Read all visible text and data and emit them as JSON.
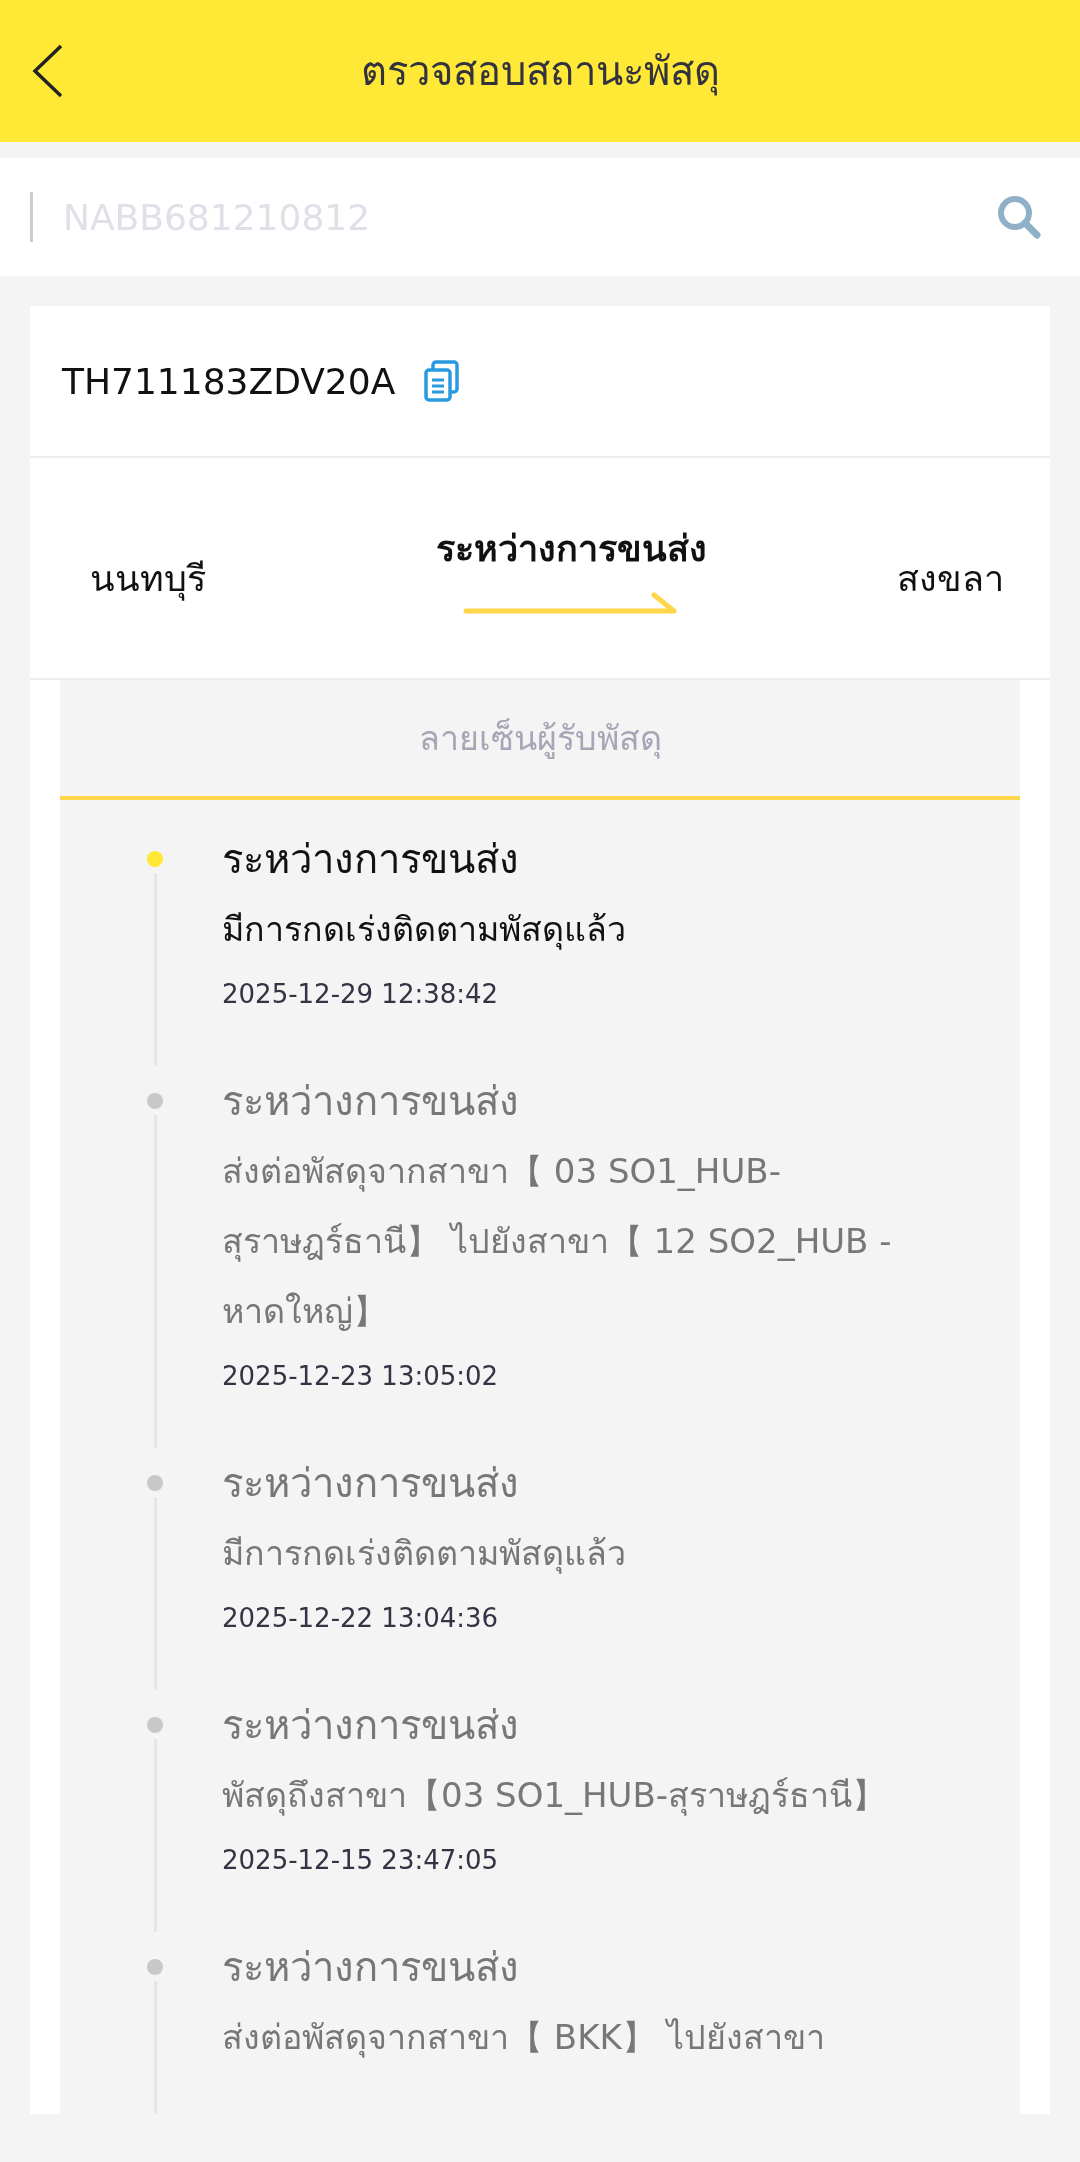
{
  "header": {
    "title": "ตรวจสอบสถานะพัสดุ"
  },
  "search": {
    "placeholder": "NABB681210812"
  },
  "parcel": {
    "tracking_number": "TH711183ZDV20A",
    "route": {
      "origin": "นนทบุรี",
      "status": "ระหว่างการขนส่ง",
      "destination": "สงขลา"
    },
    "signature_label": "ลายเซ็นผู้รับพัสดุ",
    "events": [
      {
        "status": "ระหว่างการขนส่ง",
        "detail": "มีการกดเร่งติดตามพัสดุแล้ว",
        "time": "2025-12-29 12:38:42",
        "current": true
      },
      {
        "status": "ระหว่างการขนส่ง",
        "detail": "ส่งต่อพัสดุจากสาขา【 03 SO1_HUB-สุราษฎร์ธานี】 ไปยังสาขา【 12 SO2_HUB - หาดใหญ่】",
        "time": "2025-12-23 13:05:02",
        "current": false
      },
      {
        "status": "ระหว่างการขนส่ง",
        "detail": "มีการกดเร่งติดตามพัสดุแล้ว",
        "time": "2025-12-22 13:04:36",
        "current": false
      },
      {
        "status": "ระหว่างการขนส่ง",
        "detail": "พัสดุถึงสาขา【03 SO1_HUB-สุราษฎร์ธานี】",
        "time": "2025-12-15 23:47:05",
        "current": false
      },
      {
        "status": "ระหว่างการขนส่ง",
        "detail": "ส่งต่อพัสดุจากสาขา【 BKK】 ไปยังสาขา",
        "current": false
      }
    ]
  }
}
